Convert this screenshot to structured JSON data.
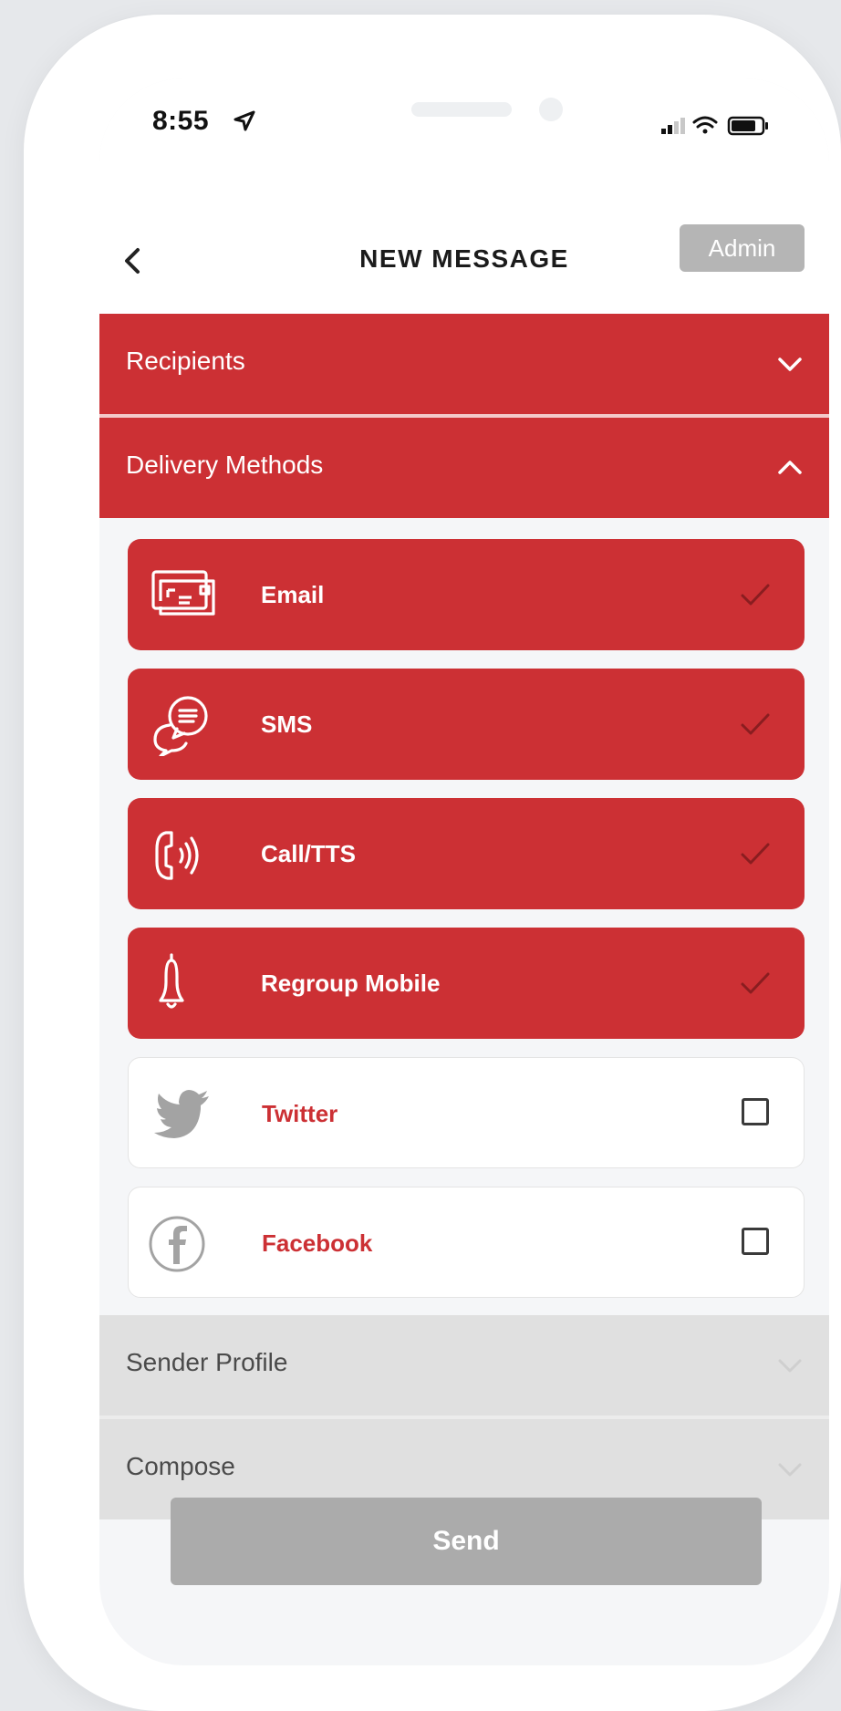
{
  "status_bar": {
    "time": "8:55"
  },
  "nav": {
    "title": "NEW MESSAGE",
    "admin_label": "Admin"
  },
  "sections": {
    "recipients": "Recipients",
    "delivery_methods": "Delivery Methods",
    "sender_profile": "Sender Profile",
    "compose": "Compose"
  },
  "methods": [
    {
      "label": "Email",
      "icon": "email-icon",
      "selected": true
    },
    {
      "label": "SMS",
      "icon": "chat-bubbles-icon",
      "selected": true
    },
    {
      "label": "Call/TTS",
      "icon": "phone-call-icon",
      "selected": true
    },
    {
      "label": "Regroup Mobile",
      "icon": "bell-icon",
      "selected": true
    },
    {
      "label": "Twitter",
      "icon": "twitter-icon",
      "selected": false
    },
    {
      "label": "Facebook",
      "icon": "facebook-icon",
      "selected": false
    }
  ],
  "send_label": "Send",
  "colors": {
    "accent": "#cc3034",
    "disabled": "#ababab",
    "section_grey": "#e0e0e0"
  }
}
